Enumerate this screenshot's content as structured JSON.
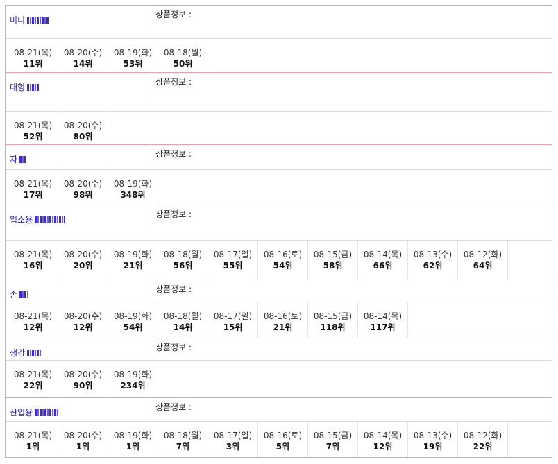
{
  "info_label": "상품정보 :",
  "products": [
    {
      "keyword": "미니",
      "mask_w": 32,
      "head_h": 47,
      "rank_h": 48,
      "ranks": [
        {
          "date": "08-21(목)",
          "rank": "11위"
        },
        {
          "date": "08-20(수)",
          "rank": "14위"
        },
        {
          "date": "08-19(화)",
          "rank": "53위"
        },
        {
          "date": "08-18(월)",
          "rank": "50위"
        }
      ]
    },
    {
      "keyword": "대형",
      "mask_w": 18,
      "head_h": 55,
      "rank_h": 47,
      "ranks": [
        {
          "date": "08-21(목)",
          "rank": "52위"
        },
        {
          "date": "08-20(수)",
          "rank": "80위"
        }
      ]
    },
    {
      "keyword": "자",
      "mask_w": 10,
      "head_h": 35,
      "rank_h": 50,
      "ranks": [
        {
          "date": "08-21(목)",
          "rank": "17위"
        },
        {
          "date": "08-20(수)",
          "rank": "98위"
        },
        {
          "date": "08-19(화)",
          "rank": "348위"
        }
      ]
    },
    {
      "keyword": "업소용",
      "mask_w": 44,
      "head_h": 50,
      "rank_h": 56,
      "ranks": [
        {
          "date": "08-21(목)",
          "rank": "16위"
        },
        {
          "date": "08-20(수)",
          "rank": "20위"
        },
        {
          "date": "08-19(화)",
          "rank": "21위"
        },
        {
          "date": "08-18(월)",
          "rank": "56위"
        },
        {
          "date": "08-17(일)",
          "rank": "55위"
        },
        {
          "date": "08-16(토)",
          "rank": "54위"
        },
        {
          "date": "08-15(금)",
          "rank": "58위"
        },
        {
          "date": "08-14(목)",
          "rank": "66위"
        },
        {
          "date": "08-13(수)",
          "rank": "62위"
        },
        {
          "date": "08-12(화)",
          "rank": "64위"
        }
      ]
    },
    {
      "keyword": "손",
      "mask_w": 12,
      "head_h": 31,
      "rank_h": 51,
      "ranks": [
        {
          "date": "08-21(목)",
          "rank": "12위"
        },
        {
          "date": "08-20(수)",
          "rank": "12위"
        },
        {
          "date": "08-19(화)",
          "rank": "54위"
        },
        {
          "date": "08-18(월)",
          "rank": "14위"
        },
        {
          "date": "08-17(일)",
          "rank": "15위"
        },
        {
          "date": "08-16(토)",
          "rank": "21위"
        },
        {
          "date": "08-15(금)",
          "rank": "118위"
        },
        {
          "date": "08-14(목)",
          "rank": "117위"
        }
      ]
    },
    {
      "keyword": "생강",
      "mask_w": 20,
      "head_h": 31,
      "rank_h": 53,
      "ranks": [
        {
          "date": "08-21(목)",
          "rank": "22위"
        },
        {
          "date": "08-20(수)",
          "rank": "90위"
        },
        {
          "date": "08-19(화)",
          "rank": "234위"
        }
      ]
    },
    {
      "keyword": "산업용",
      "mask_w": 34,
      "head_h": 33,
      "rank_h": 51,
      "ranks": [
        {
          "date": "08-21(목)",
          "rank": "1위"
        },
        {
          "date": "08-20(수)",
          "rank": "1위"
        },
        {
          "date": "08-19(화)",
          "rank": "1위"
        },
        {
          "date": "08-18(월)",
          "rank": "7위"
        },
        {
          "date": "08-17(일)",
          "rank": "3위"
        },
        {
          "date": "08-16(토)",
          "rank": "5위"
        },
        {
          "date": "08-15(금)",
          "rank": "7위"
        },
        {
          "date": "08-14(목)",
          "rank": "12위"
        },
        {
          "date": "08-13(수)",
          "rank": "19위"
        },
        {
          "date": "08-12(화)",
          "rank": "22위"
        }
      ]
    }
  ]
}
